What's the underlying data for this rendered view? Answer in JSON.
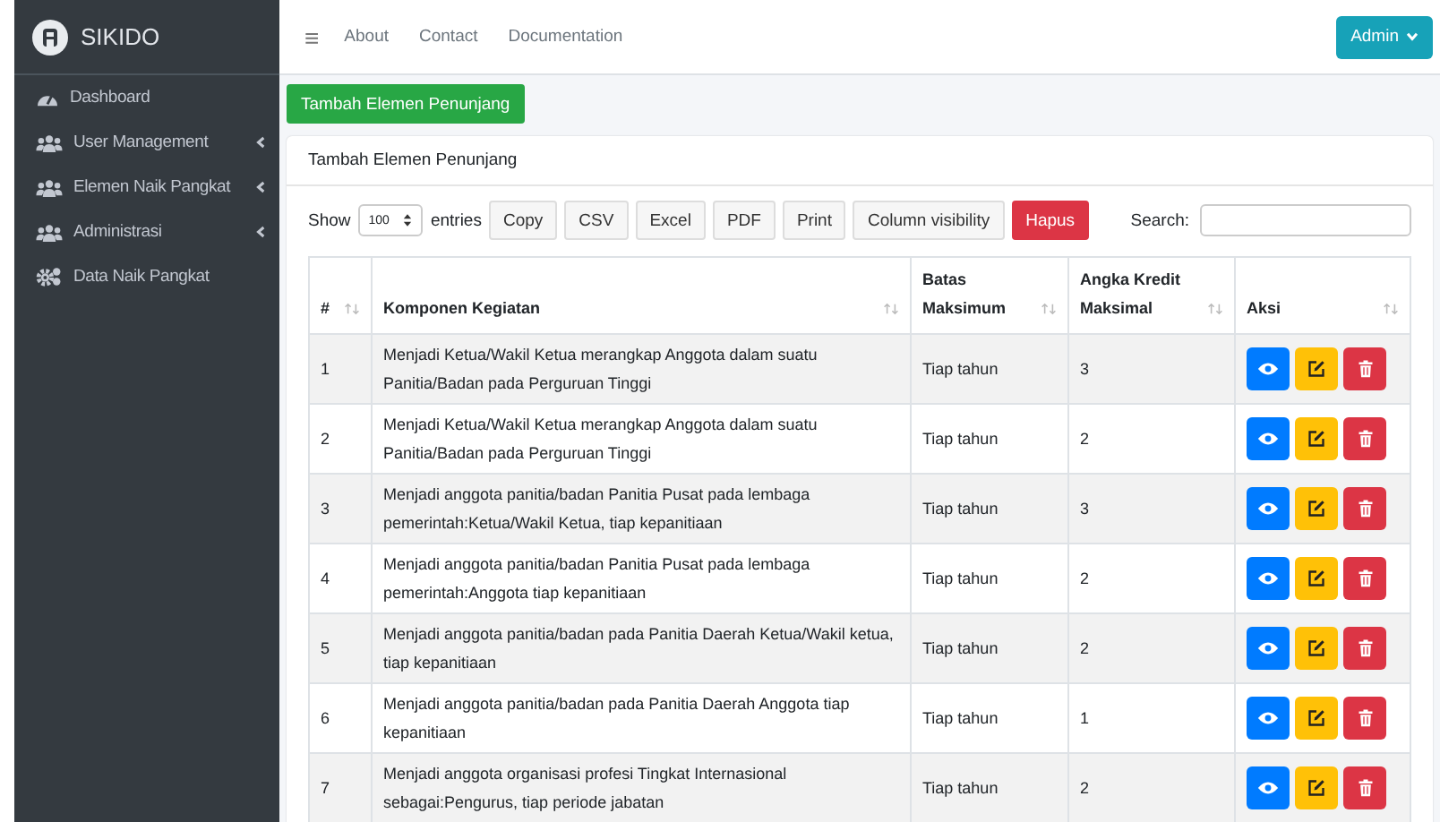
{
  "sidebar": {
    "brand": "SIKIDO",
    "items": [
      {
        "label": "Dashboard",
        "kind": "dashboard",
        "has_submenu": false
      },
      {
        "label": "User Management",
        "kind": "group",
        "has_submenu": true
      },
      {
        "label": "Elemen Naik Pangkat",
        "kind": "group",
        "has_submenu": true
      },
      {
        "label": "Administrasi",
        "kind": "group",
        "has_submenu": true
      },
      {
        "label": "Data Naik Pangkat",
        "kind": "settings",
        "has_submenu": false
      }
    ]
  },
  "navbar": {
    "menu_icon": "≡",
    "links": [
      "About",
      "Contact",
      "Documentation"
    ],
    "user_button": "Admin"
  },
  "add_button": "Tambah Elemen Penunjang",
  "card": {
    "title": "Tambah Elemen Penunjang",
    "length_control": {
      "prefix": "Show",
      "value": "100",
      "suffix": "entries"
    },
    "export_buttons": [
      {
        "label": "Copy",
        "kind": "default"
      },
      {
        "label": "CSV",
        "kind": "default"
      },
      {
        "label": "Excel",
        "kind": "default"
      },
      {
        "label": "PDF",
        "kind": "default"
      },
      {
        "label": "Print",
        "kind": "default"
      },
      {
        "label": "Column visibility",
        "kind": "default"
      },
      {
        "label": "Hapus",
        "kind": "danger"
      }
    ],
    "search_label": "Search:",
    "table": {
      "columns": [
        "#",
        "Komponen Kegiatan",
        "Batas Maksimum",
        "Angka Kredit Maksimal",
        "Aksi"
      ],
      "rows": [
        {
          "no": "1",
          "komponen": "Menjadi Ketua/Wakil Ketua merangkap Anggota dalam suatu Panitia/Badan pada Perguruan Tinggi",
          "batas": "Tiap tahun",
          "angka": "3"
        },
        {
          "no": "2",
          "komponen": "Menjadi Ketua/Wakil Ketua merangkap Anggota dalam suatu Panitia/Badan pada Perguruan Tinggi",
          "batas": "Tiap tahun",
          "angka": "2"
        },
        {
          "no": "3",
          "komponen": "Menjadi anggota panitia/badan Panitia Pusat pada lembaga pemerintah:Ketua/Wakil Ketua, tiap kepanitiaan",
          "batas": "Tiap tahun",
          "angka": "3"
        },
        {
          "no": "4",
          "komponen": "Menjadi anggota panitia/badan Panitia Pusat pada lembaga pemerintah:Anggota tiap kepanitiaan",
          "batas": "Tiap tahun",
          "angka": "2"
        },
        {
          "no": "5",
          "komponen": "Menjadi anggota panitia/badan pada Panitia Daerah Ketua/Wakil ketua, tiap kepanitiaan",
          "batas": "Tiap tahun",
          "angka": "2"
        },
        {
          "no": "6",
          "komponen": "Menjadi anggota panitia/badan pada Panitia Daerah Anggota tiap kepanitiaan",
          "batas": "Tiap tahun",
          "angka": "1"
        },
        {
          "no": "7",
          "komponen": "Menjadi anggota organisasi profesi Tingkat Internasional sebagai:Pengurus, tiap periode jabatan",
          "batas": "Tiap tahun",
          "angka": "2"
        }
      ]
    }
  }
}
